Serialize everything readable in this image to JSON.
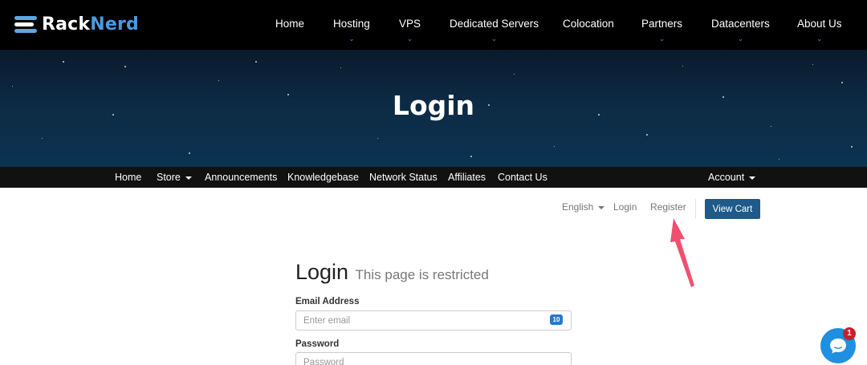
{
  "brand": {
    "name_part1": "Rack",
    "name_part2": "Nerd"
  },
  "main_nav": [
    {
      "label": "Home",
      "dropdown": false
    },
    {
      "label": "Hosting",
      "dropdown": true
    },
    {
      "label": "VPS",
      "dropdown": true
    },
    {
      "label": "Dedicated Servers",
      "dropdown": true
    },
    {
      "label": "Colocation",
      "dropdown": false
    },
    {
      "label": "Partners",
      "dropdown": true
    },
    {
      "label": "Datacenters",
      "dropdown": true
    },
    {
      "label": "About Us",
      "dropdown": true
    }
  ],
  "hero": {
    "title": "Login"
  },
  "sub_nav": {
    "items": [
      {
        "label": "Home"
      },
      {
        "label": "Store",
        "dropdown": true
      },
      {
        "label": "Announcements"
      },
      {
        "label": "Knowledgebase"
      },
      {
        "label": "Network Status"
      },
      {
        "label": "Affiliates"
      },
      {
        "label": "Contact Us"
      }
    ],
    "account": {
      "label": "Account",
      "dropdown": true
    }
  },
  "utility": {
    "language": "English",
    "login": "Login",
    "register": "Register",
    "view_cart": "View Cart"
  },
  "login_form": {
    "heading": "Login",
    "subheading": "This page is restricted",
    "email_label": "Email Address",
    "email_placeholder": "Enter email",
    "email_icon_text": "10",
    "password_label": "Password",
    "password_placeholder": "Password"
  },
  "chat_widget": {
    "badge_count": "1"
  },
  "colors": {
    "brand_blue": "#4a9be0",
    "button_blue": "#1e5a8a",
    "chat_blue": "#1f8fe0",
    "annotation_arrow": "#f0506e"
  }
}
